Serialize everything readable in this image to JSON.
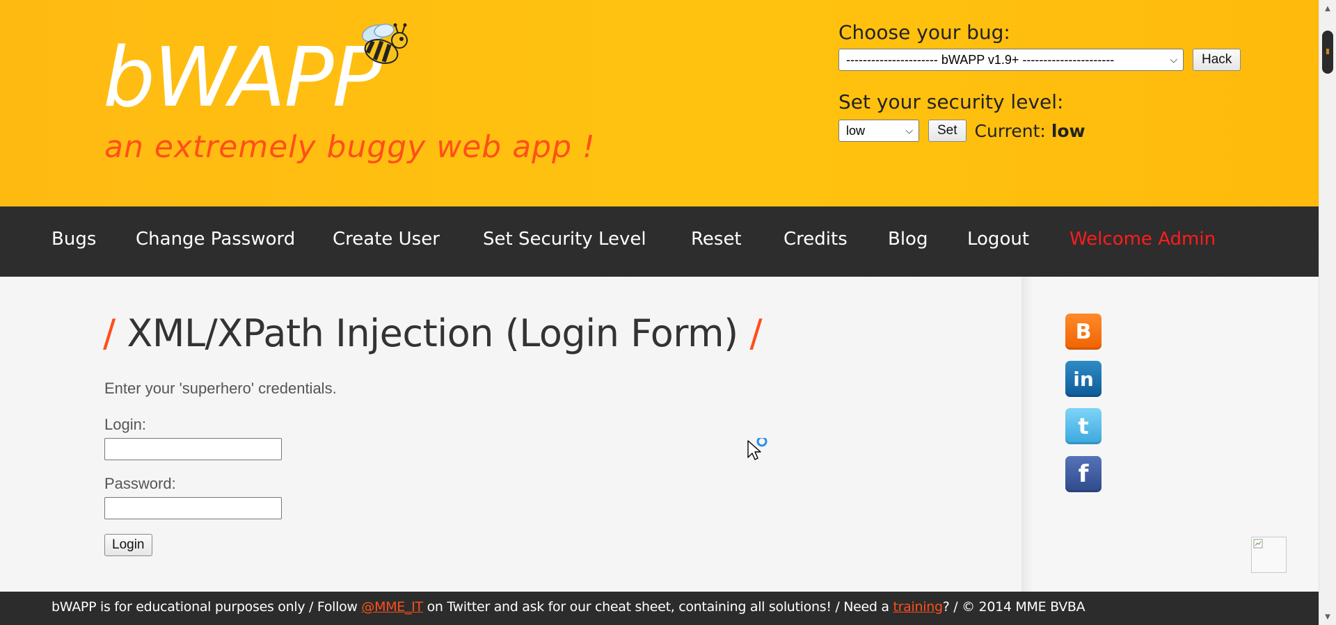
{
  "header": {
    "logo": "bWAPP",
    "tagline": "an extremely buggy web app !",
    "bug_label": "Choose your bug:",
    "bug_selected": "---------------------- bWAPP v1.9+ ----------------------",
    "hack_button": "Hack",
    "security_label": "Set your security level:",
    "security_selected": "low",
    "set_button": "Set",
    "current_label": "Current:",
    "current_value": "low"
  },
  "nav": {
    "items": [
      {
        "label": "Bugs"
      },
      {
        "label": "Change Password"
      },
      {
        "label": "Create User"
      },
      {
        "label": "Set Security Level"
      },
      {
        "label": "Reset"
      },
      {
        "label": "Credits"
      },
      {
        "label": "Blog"
      },
      {
        "label": "Logout"
      },
      {
        "label": "Welcome Admin"
      }
    ]
  },
  "main": {
    "title_slash_left": "/",
    "title": "XML/XPath Injection (Login Form)",
    "title_slash_right": "/",
    "intro": "Enter your 'superhero' credentials.",
    "login_label": "Login:",
    "login_value": "",
    "password_label": "Password:",
    "password_value": "",
    "login_button": "Login"
  },
  "social": {
    "blogger_icon": "blogger-icon",
    "linkedin_icon": "linkedin-icon",
    "twitter_icon": "twitter-icon",
    "facebook_icon": "facebook-icon",
    "blogger_glyph": "B",
    "linkedin_glyph": "in",
    "twitter_glyph": "t",
    "facebook_glyph": "f"
  },
  "footer": {
    "part1": "bWAPP is for educational purposes only / Follow ",
    "twitter_link": "@MME_IT",
    "part2": " on Twitter and ask for our cheat sheet, containing all solutions! / Need a ",
    "training_link": "training",
    "part3": "? / © 2014 MME BVBA"
  },
  "colors": {
    "header_bg": "#ffbb11",
    "nav_bg": "#2c2c2c",
    "accent": "#ff4f1a",
    "welcome": "#ff1c1c"
  }
}
